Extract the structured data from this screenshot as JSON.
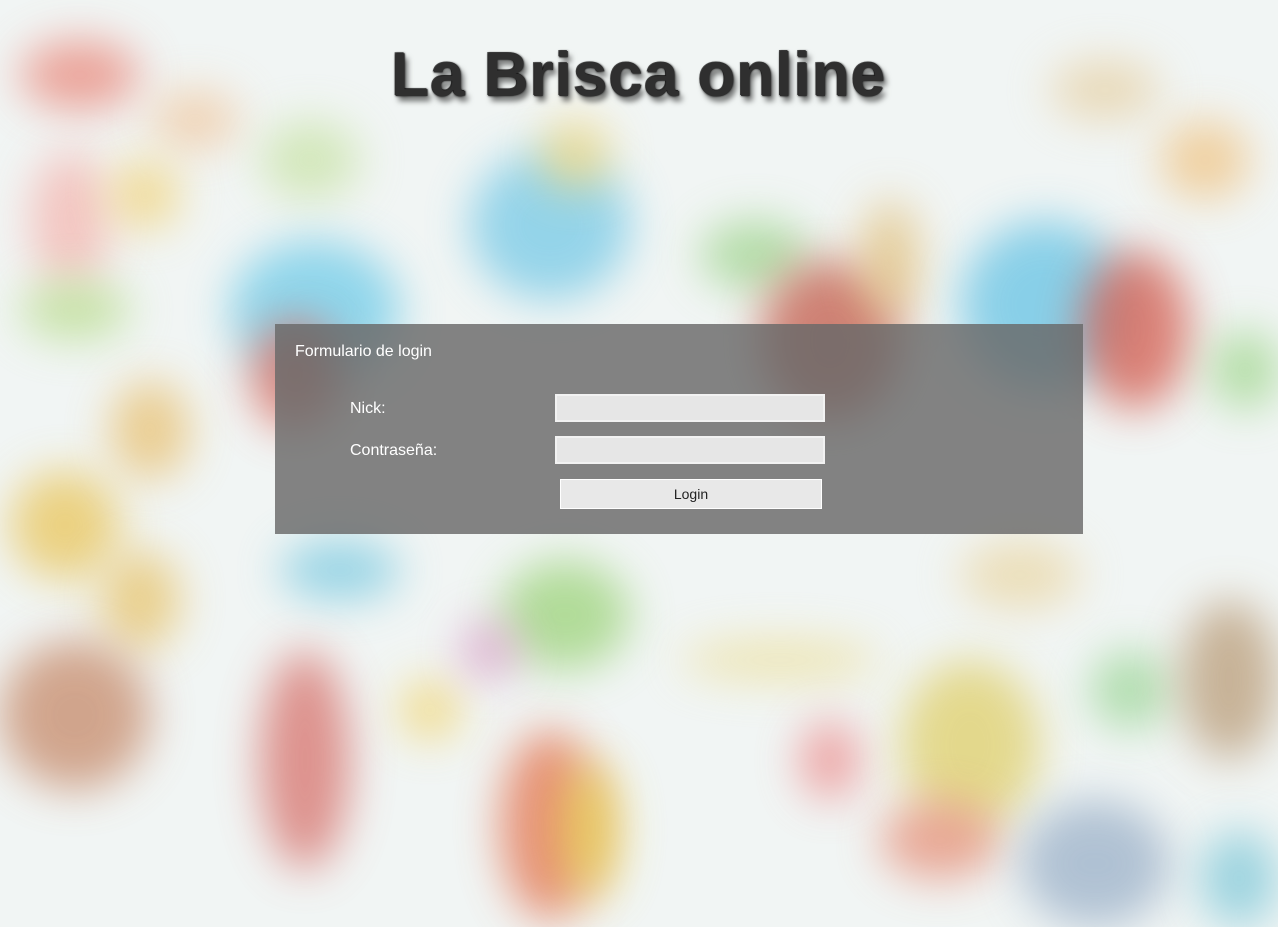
{
  "page": {
    "title": "La Brisca online"
  },
  "login_form": {
    "heading": "Formulario de login",
    "nick_label": "Nick:",
    "nick_value": "",
    "password_label": "Contraseña:",
    "password_value": "",
    "submit_label": "Login"
  },
  "colors": {
    "panel_background": "#696969",
    "input_background": "#e6e6e6",
    "title_text": "#2f2f2f"
  }
}
